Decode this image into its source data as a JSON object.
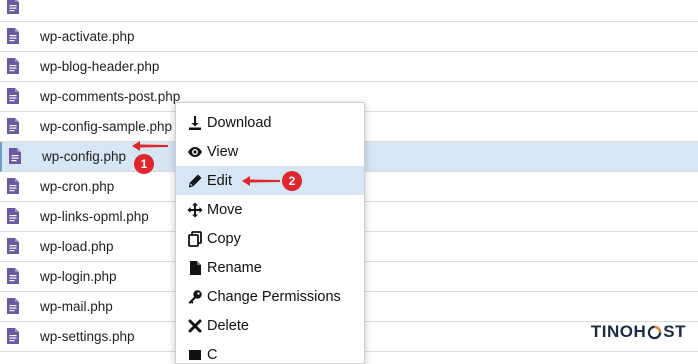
{
  "files": [
    {
      "name": ""
    },
    {
      "name": "wp-activate.php"
    },
    {
      "name": "wp-blog-header.php"
    },
    {
      "name": "wp-comments-post.php"
    },
    {
      "name": "wp-config-sample.php"
    },
    {
      "name": "wp-config.php",
      "selected": true
    },
    {
      "name": "wp-cron.php"
    },
    {
      "name": "wp-links-opml.php"
    },
    {
      "name": "wp-load.php"
    },
    {
      "name": "wp-login.php"
    },
    {
      "name": "wp-mail.php"
    },
    {
      "name": "wp-settings.php"
    }
  ],
  "context_menu": {
    "items": [
      {
        "label": "Download",
        "icon": "download-icon"
      },
      {
        "label": "View",
        "icon": "eye-icon"
      },
      {
        "label": "Edit",
        "icon": "pencil-icon",
        "highlighted": true
      },
      {
        "label": "Move",
        "icon": "move-arrows-icon"
      },
      {
        "label": "Copy",
        "icon": "copy-icon"
      },
      {
        "label": "Rename",
        "icon": "file-icon"
      },
      {
        "label": "Change Permissions",
        "icon": "key-icon"
      },
      {
        "label": "Delete",
        "icon": "x-icon"
      },
      {
        "label": "C",
        "icon": "partial-icon"
      }
    ]
  },
  "annotations": {
    "step1": "1",
    "step2": "2",
    "color": "#e0262d"
  },
  "logo": {
    "part1": "TINO",
    "part2": "H",
    "part3": "ST"
  }
}
